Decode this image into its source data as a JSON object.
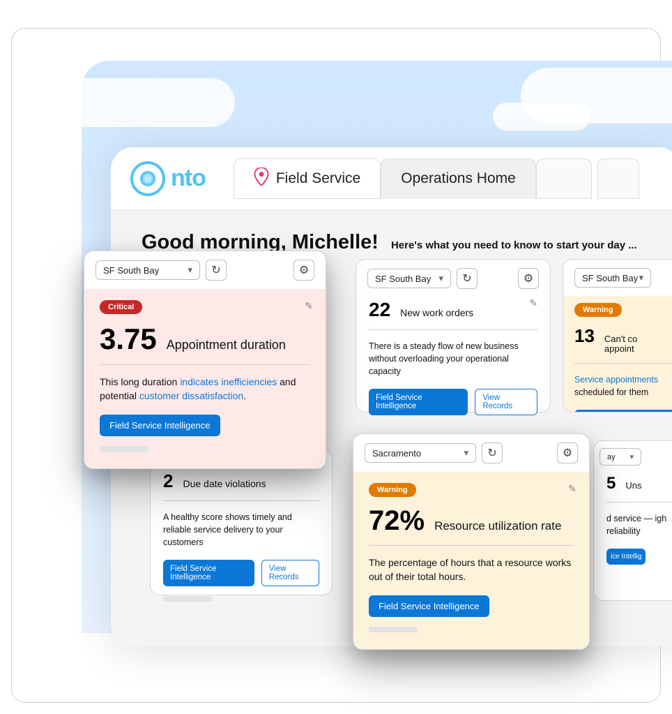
{
  "brand": {
    "name": "nto"
  },
  "nav": {
    "field_service": "Field Service",
    "operations_home": "Operations Home"
  },
  "greeting": {
    "headline": "Good morning, Michelle!",
    "sub": "Here's what you need to know to start your day ..."
  },
  "regions": {
    "sf_south_bay": "SF South Bay",
    "sacramento": "Sacramento"
  },
  "badges": {
    "critical": "Critical",
    "warning": "Warning"
  },
  "buttons": {
    "fsi": "Field Service Intelligence",
    "view_records": "View Records"
  },
  "cards": {
    "duration": {
      "value": "3.75",
      "label": "Appointment duration",
      "desc_pre": "This long duration ",
      "desc_link1": "indicates inefficiencies",
      "desc_mid": " and potential ",
      "desc_link2": "customer dissatisfaction",
      "desc_post": "."
    },
    "new_orders": {
      "value": "22",
      "label": "New work orders",
      "desc": "There is a steady flow of new business without overloading your operational capacity"
    },
    "cant_complete": {
      "value": "13",
      "label": "Can't complete appointments",
      "desc_link": "Service appointments",
      "desc_post": " scheduled for them"
    },
    "due_date": {
      "value": "2",
      "label": "Due date violations",
      "desc": "A healthy score shows timely and reliable service delivery to your customers"
    },
    "utilization": {
      "value": "72%",
      "label": "Resource utilization rate",
      "desc": "The percentage of hours that a resource works out of their total hours."
    },
    "unscheduled": {
      "value": "5",
      "label": "Unscheduled",
      "desc": "d service — igh reliability"
    }
  }
}
